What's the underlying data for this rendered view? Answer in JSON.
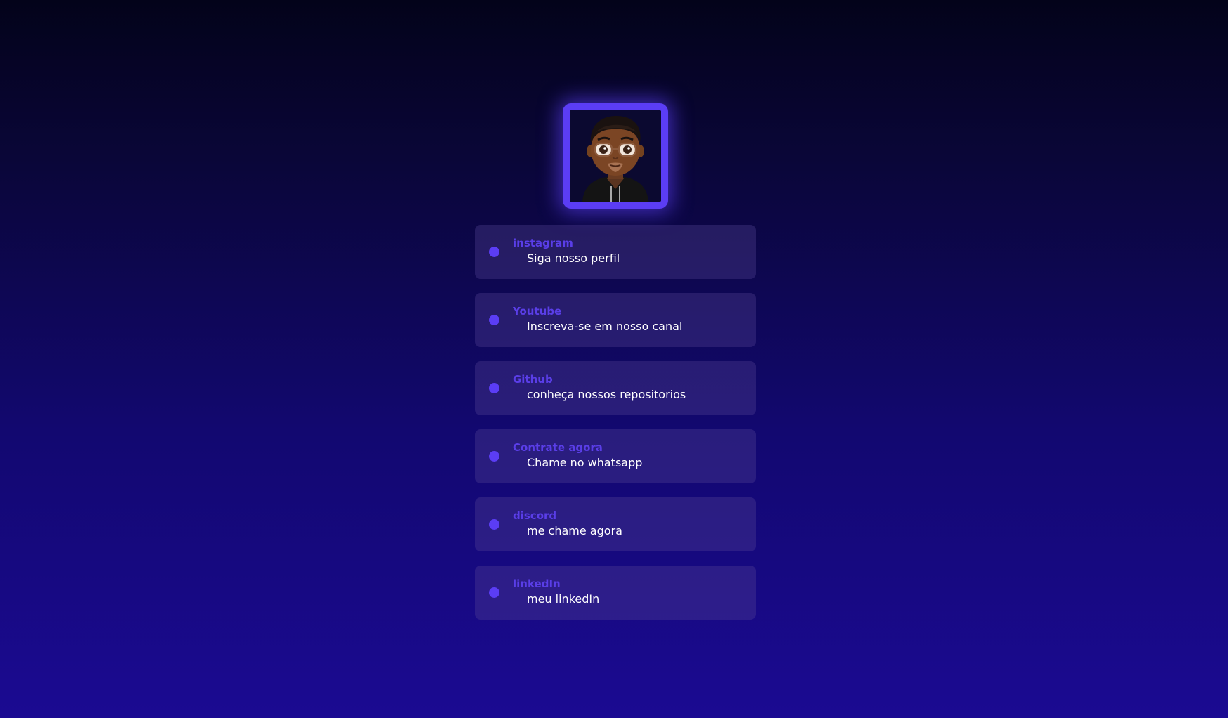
{
  "profile": {
    "avatar_icon": "memoji-avatar"
  },
  "colors": {
    "accent": "#5b3df5",
    "title_text": "#5a3ee8",
    "subtitle_text": "#ffffff",
    "card_background": "#2a1f6e",
    "background_top": "#03031a",
    "background_bottom": "#1b0a92"
  },
  "links": [
    {
      "title": "instagram",
      "subtitle": "Siga nosso perfil"
    },
    {
      "title": "Youtube",
      "subtitle": "Inscreva-se em nosso canal"
    },
    {
      "title": "Github",
      "subtitle": "conheça nossos repositorios"
    },
    {
      "title": "Contrate agora",
      "subtitle": "Chame no whatsapp"
    },
    {
      "title": "discord",
      "subtitle": "me chame agora"
    },
    {
      "title": "linkedIn",
      "subtitle": "meu linkedIn"
    }
  ]
}
